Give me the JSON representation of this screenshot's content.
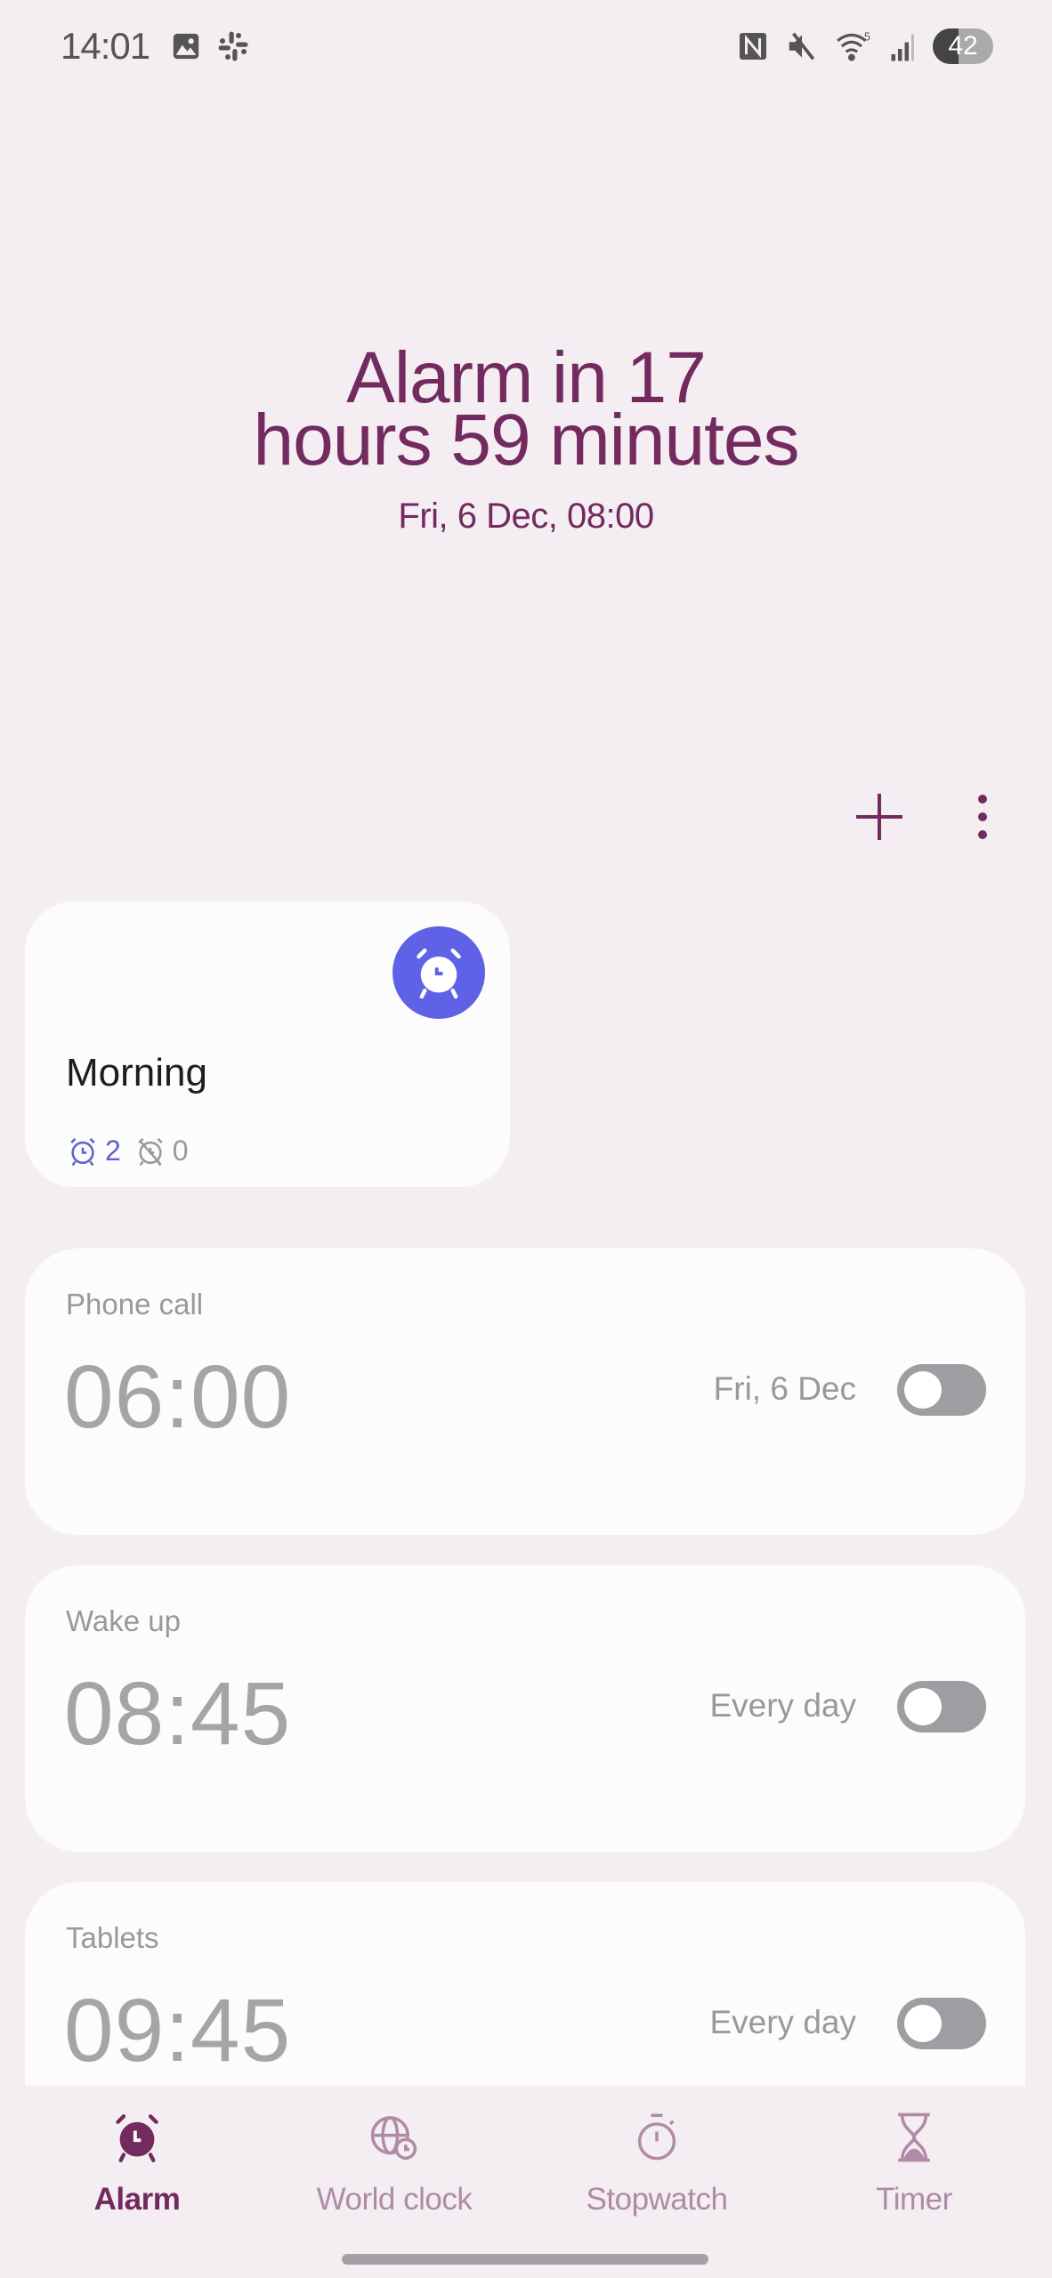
{
  "status_bar": {
    "time": "14:01",
    "left_icons": [
      "gallery-icon",
      "slack-icon"
    ],
    "right_icons": [
      "nfc-icon",
      "mute-icon",
      "wifi-icon",
      "signal-icon"
    ],
    "battery": "42",
    "battery_level_percent": 42
  },
  "hero": {
    "title_line1": "Alarm in 17",
    "title_line2": "hours 59 minutes",
    "next_alarm": "Fri, 6 Dec, 08:00"
  },
  "colors": {
    "accent": "#722a5f",
    "preset_badge": "#5f62e6",
    "background": "#f4eef3",
    "card": "#fcfcfc"
  },
  "toolbar": {
    "add_icon": "plus-icon",
    "more_icon": "more-vertical-icon"
  },
  "preset": {
    "name": "Morning",
    "active_count": "2",
    "inactive_count": "0"
  },
  "alarms": [
    {
      "label": "Phone call",
      "time": "06:00",
      "repeat": "Fri, 6 Dec",
      "enabled": false
    },
    {
      "label": "Wake up",
      "time": "08:45",
      "repeat": "Every day",
      "enabled": false
    },
    {
      "label": "Tablets",
      "time": "09:45",
      "repeat": "Every day",
      "enabled": false
    }
  ],
  "nav": {
    "items": [
      {
        "label": "Alarm",
        "icon": "alarm-icon",
        "active": true
      },
      {
        "label": "World clock",
        "icon": "globe-clock-icon",
        "active": false
      },
      {
        "label": "Stopwatch",
        "icon": "stopwatch-icon",
        "active": false
      },
      {
        "label": "Timer",
        "icon": "hourglass-icon",
        "active": false
      }
    ]
  }
}
